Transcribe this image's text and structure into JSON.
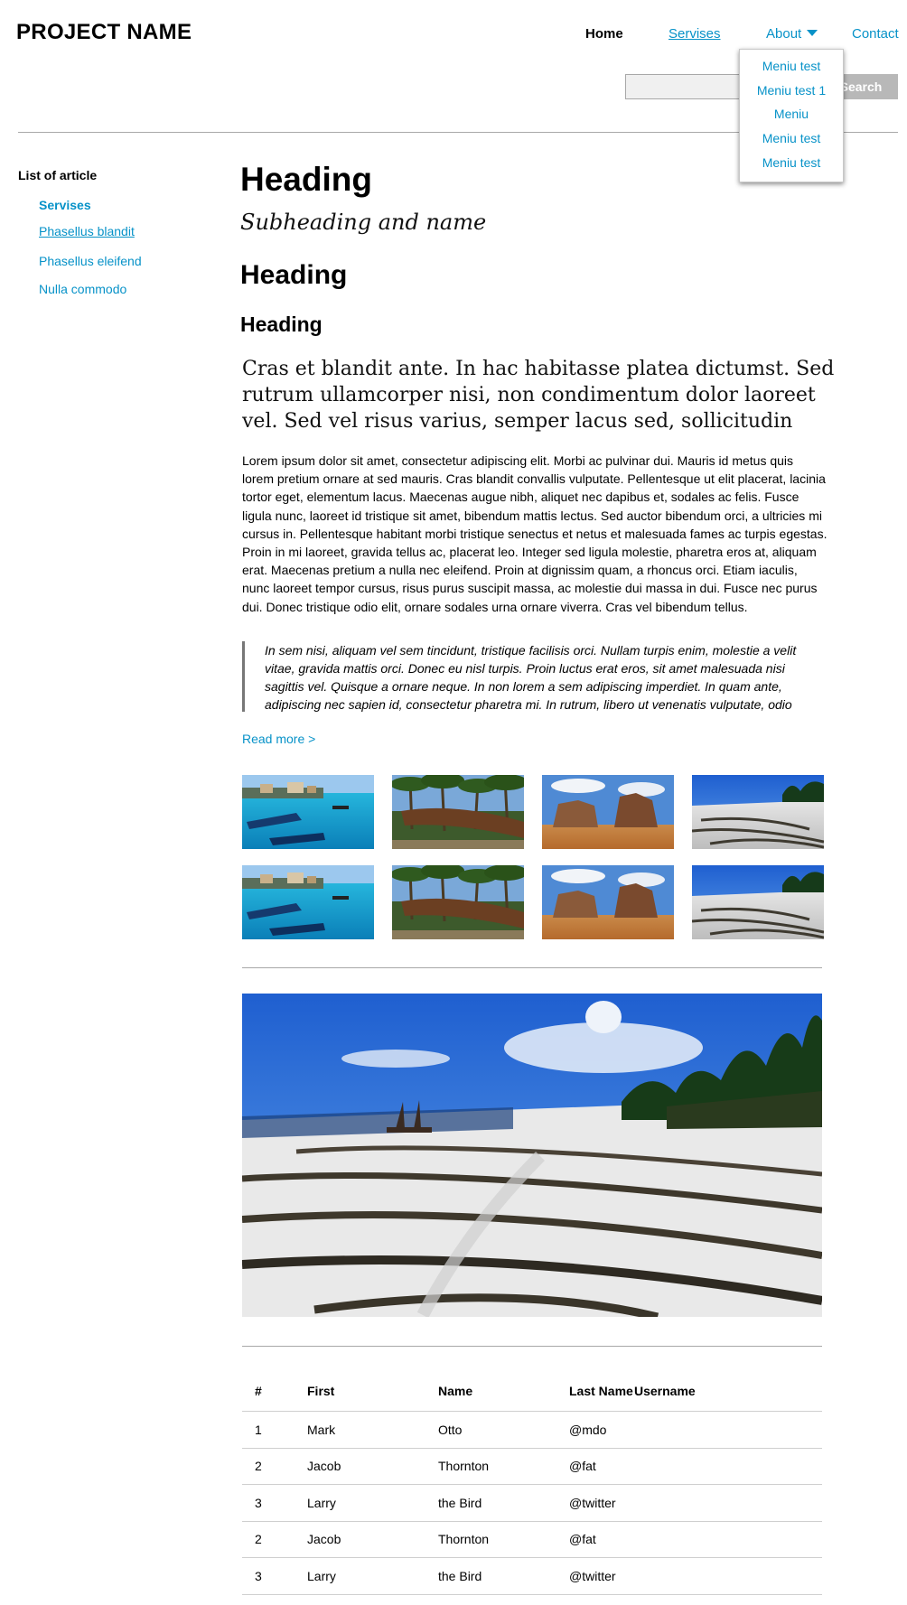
{
  "header": {
    "brand": "PROJECT NAME",
    "nav": {
      "home": "Home",
      "servises": "Servises",
      "about": "About",
      "contact": "Contact"
    },
    "about_menu": [
      "Meniu test",
      "Meniu test 1",
      "Meniu",
      "Meniu test",
      "Meniu test"
    ],
    "search": {
      "placeholder": "",
      "button": "Search"
    }
  },
  "sidebar": {
    "title": "List of article",
    "items": [
      {
        "label": "Servises",
        "state": "active"
      },
      {
        "label": "Phasellus blandit",
        "state": "hover"
      },
      {
        "label": "Phasellus eleifend",
        "state": "normal"
      },
      {
        "label": "Nulla commodo",
        "state": "normal"
      }
    ]
  },
  "article": {
    "heading1": "Heading",
    "subheading": "Subheading and name",
    "heading2": "Heading",
    "heading3": "Heading",
    "lead": "Cras et blandit ante. In hac habitasse platea dictumst. Sed rutrum ullamcorper nisi, non condimentum dolor laoreet vel. Sed vel risus varius, semper lacus sed, sollicitudin",
    "body": "Lorem ipsum dolor sit amet, consectetur adipiscing elit. Morbi ac pulvinar dui. Mauris id metus quis lorem pretium ornare at sed mauris. Cras blandit convallis vulputate. Pellentesque ut elit placerat, lacinia tortor eget, elementum lacus. Maecenas augue nibh, aliquet nec dapibus et, sodales ac felis. Fusce ligula nunc, laoreet id tristique sit amet, bibendum mattis lectus. Sed auctor bibendum orci, a ultricies mi cursus in. Pellentesque habitant morbi tristique senectus et netus et malesuada fames ac turpis egestas. Proin in mi laoreet, gravida tellus ac, placerat leo. Integer sed ligula molestie, pharetra eros at, aliquam erat. Maecenas pretium a nulla nec eleifend. Proin at dignissim quam, a rhoncus orci. Etiam iaculis, nunc laoreet tempor cursus, risus purus suscipit massa, ac molestie dui massa in dui. Fusce nec purus dui. Donec tristique odio elit, ornare sodales urna ornare viverra. Cras vel bibendum tellus.",
    "quote": "In sem nisi, aliquam vel sem tincidunt, tristique facilisis orci. Nullam turpis enim, molestie a velit vitae, gravida mattis orci. Donec eu nisl turpis. Proin luctus erat eros, sit amet malesuada nisi sagittis vel. Quisque a ornare neque. In non lorem a sem adipiscing imperdiet. In quam ante, adipiscing nec sapien id, consectetur pharetra mi. In rutrum, libero ut venenatis vulputate, odio",
    "read_more": "Read more >"
  },
  "gallery": {
    "thumbnails": [
      "harbor-boats-photo",
      "palm-boat-photo",
      "rock-formation-photo",
      "beach-seaweed-photo",
      "harbor-boats-photo",
      "palm-boat-photo",
      "rock-formation-photo",
      "beach-seaweed-photo"
    ],
    "featured": "beach-seaweed-photo"
  },
  "table": {
    "headers": [
      "#",
      "First",
      "Name",
      "Last Name",
      "Username"
    ],
    "rows": [
      [
        "1",
        "Mark",
        "Otto",
        "@mdo"
      ],
      [
        "2",
        "Jacob",
        "Thornton",
        "@fat"
      ],
      [
        "3",
        "Larry",
        "the Bird",
        "@twitter"
      ],
      [
        "2",
        "Jacob",
        "Thornton",
        "@fat"
      ],
      [
        "3",
        "Larry",
        "the Bird",
        "@twitter"
      ]
    ]
  },
  "colors": {
    "link": "#0792c8",
    "rule": "#a8a8a8",
    "search_button": "#b8b8b8"
  }
}
